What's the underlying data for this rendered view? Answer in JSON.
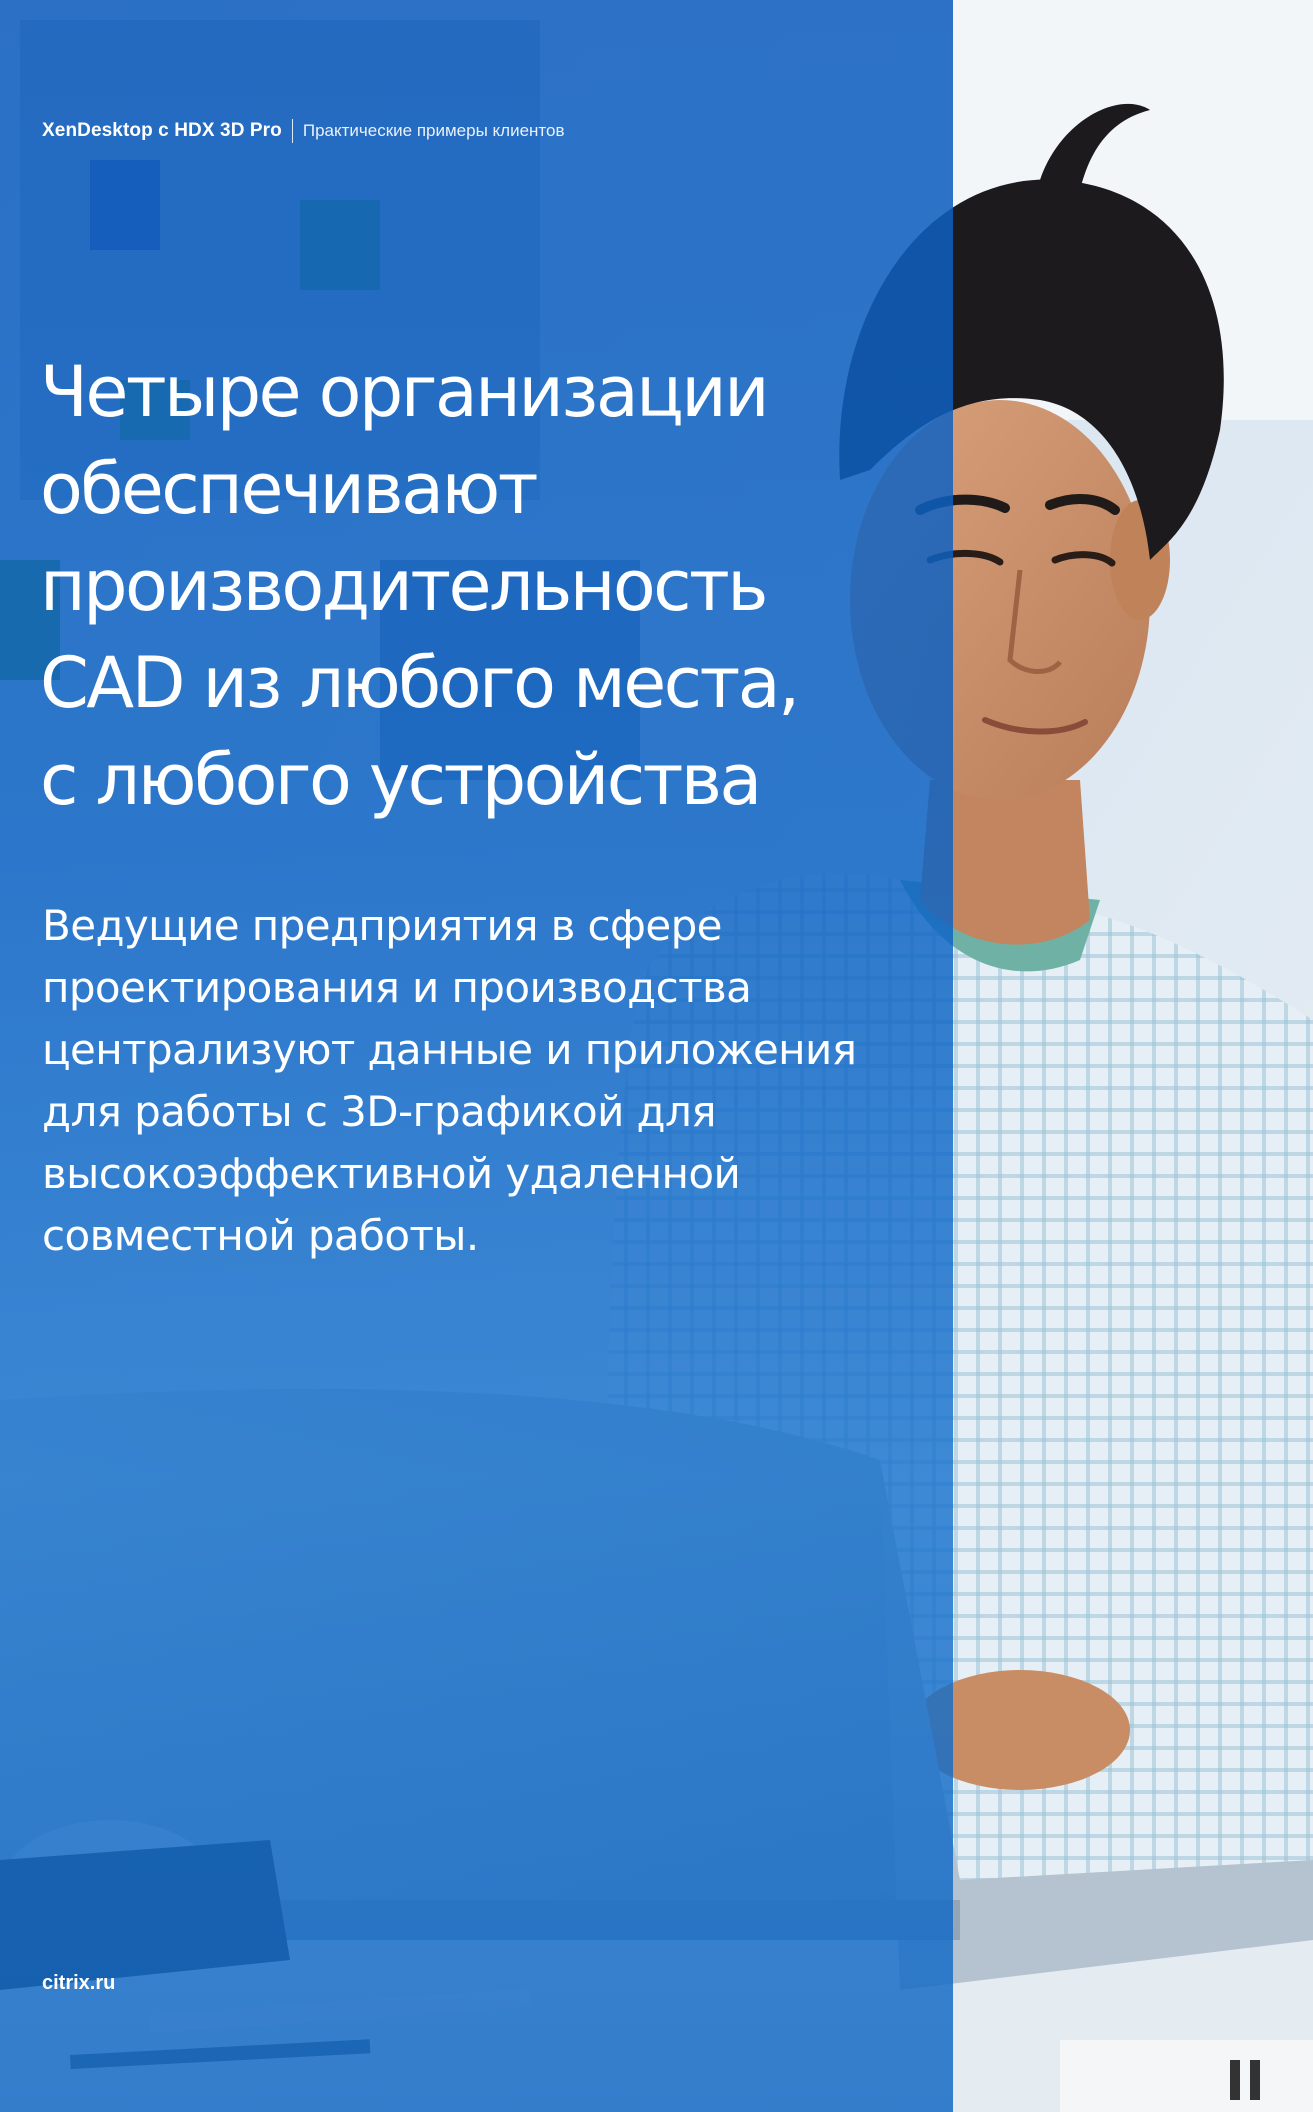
{
  "header": {
    "product": "XenDesktop с HDX 3D Pro",
    "section": "Практические примеры клиентов"
  },
  "headline": {
    "lines": [
      "Четыре организации",
      "обеспечивают",
      "производительность",
      "CAD из любого места,",
      "с любого устройства"
    ]
  },
  "subtext": {
    "lines": [
      "Ведущие предприятия в сфере",
      "проектирования и производства",
      "централизуют данные и приложения",
      "для работы с 3D-графикой для",
      "высокоэффективной удаленной",
      "совместной работы."
    ]
  },
  "footer": {
    "url": "citrix.ru"
  },
  "colors": {
    "panel_blue": "#0c62c4",
    "text": "#ffffff"
  }
}
